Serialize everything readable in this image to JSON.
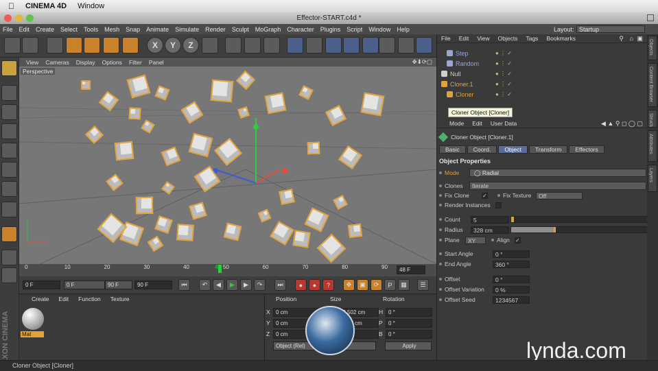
{
  "os_menu": {
    "app": "CINEMA 4D",
    "window": "Window"
  },
  "window": {
    "title": "Effector-START.c4d *"
  },
  "menus": [
    "File",
    "Edit",
    "Create",
    "Select",
    "Tools",
    "Mesh",
    "Snap",
    "Animate",
    "Simulate",
    "Render",
    "Sculpt",
    "MoGraph",
    "Character",
    "Plugins",
    "Script",
    "Window",
    "Help"
  ],
  "layout": {
    "label": "Layout:",
    "value": "Startup"
  },
  "toolbar_icons": [
    "undo-icon",
    "redo-icon",
    "live-select-icon",
    "move-icon",
    "scale-icon",
    "rotate-icon",
    "last-tool-icon",
    "x-axis-icon",
    "y-axis-icon",
    "z-axis-icon",
    "coordinate-system-icon",
    "render-view-icon",
    "render-picture-viewer-icon",
    "render-settings-icon",
    "cube-icon",
    "pen-spline-icon",
    "subdivision-icon",
    "cloner-icon",
    "deformer-icon",
    "floor-icon",
    "camera-icon",
    "light-icon"
  ],
  "axis_labels": [
    "X",
    "Y",
    "Z"
  ],
  "viewport": {
    "menu": [
      "View",
      "Cameras",
      "Display",
      "Options",
      "Filter",
      "Panel"
    ],
    "label": "Perspective"
  },
  "timeline": {
    "ticks": [
      "0",
      "10",
      "20",
      "30",
      "40",
      "48",
      "50",
      "60",
      "70",
      "80",
      "90"
    ],
    "current_frame": "48 F",
    "start_field": "0 F",
    "range_start": "0 F",
    "range_end": "90 F",
    "end_field": "90 F"
  },
  "material_manager": {
    "menu": [
      "Create",
      "Edit",
      "Function",
      "Texture"
    ],
    "material_name": "Mat"
  },
  "coordinates": {
    "headers": [
      "Position",
      "Size",
      "Rotation"
    ],
    "rows": [
      {
        "axis": "X",
        "pos": "0 cm",
        "size_axis": "X",
        "size": "1083.502 cm",
        "rot_axis": "H",
        "rot": "0 °"
      },
      {
        "axis": "Y",
        "pos": "0 cm",
        "size_axis": "Y",
        "size": "1083.77 cm",
        "rot_axis": "P",
        "rot": "0 °"
      },
      {
        "axis": "Z",
        "pos": "0 cm",
        "size_axis": "Z",
        "size": "",
        "rot_axis": "B",
        "rot": "0 °"
      }
    ],
    "mode": "Object (Rel)",
    "apply": "Apply"
  },
  "object_manager": {
    "menu": [
      "File",
      "Edit",
      "View",
      "Objects",
      "Tags",
      "Bookmarks"
    ],
    "objects": [
      {
        "name": "Step",
        "indent": 1,
        "color": "#9aa6d8"
      },
      {
        "name": "Random",
        "indent": 1,
        "color": "#9aa6d8"
      },
      {
        "name": "Null",
        "indent": 0,
        "color": "#cfcfcf"
      },
      {
        "name": "Cloner.1",
        "indent": 0,
        "color": "#e3a13a"
      },
      {
        "name": "Cloner",
        "indent": 1,
        "color": "#e3a13a"
      }
    ],
    "tooltip": "Cloner Object [Cloner]"
  },
  "attributes": {
    "menu": [
      "Mode",
      "Edit",
      "User Data"
    ],
    "title": "Cloner Object [Cloner.1]",
    "tabs": [
      "Basic",
      "Coord.",
      "Object",
      "Transform",
      "Effectors"
    ],
    "active_tab": "Object",
    "section": "Object Properties",
    "mode_label": "Mode",
    "mode_value": "Radial",
    "clones_label": "Clones",
    "clones_value": "Iterate",
    "fix_clone": "Fix Clone",
    "fix_texture": "Fix Texture",
    "fix_texture_value": "Off",
    "render_instances": "Render Instances",
    "count_label": "Count",
    "count_value": "5",
    "count_level": 0.02,
    "radius_label": "Radius",
    "radius_value": "328 cm",
    "radius_level": 0.33,
    "plane_label": "Plane",
    "plane_value": "XY",
    "align_label": "Align",
    "start_angle_label": "Start Angle",
    "start_angle_value": "0 °",
    "end_angle_label": "End Angle",
    "end_angle_value": "360 °",
    "offset_label": "Offset",
    "offset_value": "0 °",
    "offset_var_label": "Offset Variation",
    "offset_var_value": "0 %",
    "offset_seed_label": "Offset Seed",
    "offset_seed_value": "1234567"
  },
  "right_tabs": [
    "Objects",
    "Content Browser",
    "Structure",
    "Attributes",
    "Layers"
  ],
  "statusbar": "Cloner Object [Cloner]",
  "watermark": "lynda.com",
  "maxon_logo": "MAXON CINEMA 4D",
  "colors": {
    "accent": "#e3a13a",
    "active_tab": "#5b6b9a",
    "panel": "#3a3a3a"
  }
}
